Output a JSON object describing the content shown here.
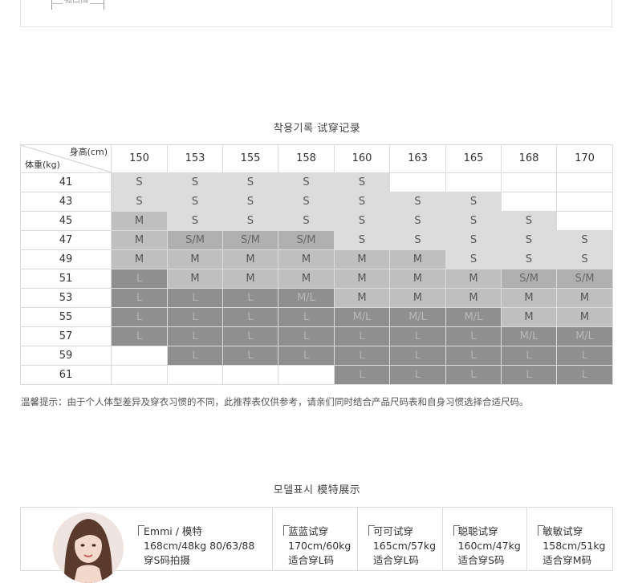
{
  "top_box": {
    "ruler_label": "袖口围"
  },
  "fit_section": {
    "title": "착용기록 试穿记录",
    "corner_height_label": "身高(cm)",
    "corner_weight_label": "体重(kg)",
    "heights": [
      "150",
      "153",
      "155",
      "158",
      "160",
      "163",
      "165",
      "168",
      "170"
    ],
    "rows": [
      {
        "weight": "41",
        "sizes": [
          "S",
          "S",
          "S",
          "S",
          "S",
          "",
          "",
          "",
          ""
        ]
      },
      {
        "weight": "43",
        "sizes": [
          "S",
          "S",
          "S",
          "S",
          "S",
          "S",
          "S",
          "",
          ""
        ]
      },
      {
        "weight": "45",
        "sizes": [
          "M",
          "S",
          "S",
          "S",
          "S",
          "S",
          "S",
          "S",
          ""
        ]
      },
      {
        "weight": "47",
        "sizes": [
          "M",
          "S/M",
          "S/M",
          "S/M",
          "S",
          "S",
          "S",
          "S",
          "S"
        ]
      },
      {
        "weight": "49",
        "sizes": [
          "M",
          "M",
          "M",
          "M",
          "M",
          "M",
          "S",
          "S",
          "S"
        ]
      },
      {
        "weight": "51",
        "sizes": [
          "L",
          "M",
          "M",
          "M",
          "M",
          "M",
          "M",
          "S/M",
          "S/M"
        ]
      },
      {
        "weight": "53",
        "sizes": [
          "L",
          "L",
          "L",
          "M/L",
          "M",
          "M",
          "M",
          "M",
          "M"
        ]
      },
      {
        "weight": "55",
        "sizes": [
          "L",
          "L",
          "L",
          "L",
          "M/L",
          "M/L",
          "M/L",
          "M",
          "M"
        ]
      },
      {
        "weight": "57",
        "sizes": [
          "L",
          "L",
          "L",
          "L",
          "L",
          "L",
          "L",
          "M/L",
          "M/L"
        ]
      },
      {
        "weight": "59",
        "sizes": [
          "",
          "L",
          "L",
          "L",
          "L",
          "L",
          "L",
          "L",
          "L"
        ]
      },
      {
        "weight": "61",
        "sizes": [
          "",
          "",
          "",
          "",
          "L",
          "L",
          "L",
          "L",
          "L"
        ]
      }
    ],
    "note": "温馨提示：由于个人体型差异及穿衣习惯的不同，此推荐表仅供参考，请亲们同时结合产品尺码表和自身习惯选择合适尺码。"
  },
  "models_section": {
    "title": "모델표시 模特展示",
    "models": [
      {
        "name": "Emmi / 模特",
        "line1": "168cm/48kg  80/63/88",
        "line2": "穿S码拍摄"
      },
      {
        "name": "蓝蓝试穿",
        "line1": "170cm/60kg",
        "line2": "适合穿L码"
      },
      {
        "name": "可可试穿",
        "line1": "165cm/57kg",
        "line2": "适合穿L码"
      },
      {
        "name": "聪聪试穿",
        "line1": "160cm/47kg",
        "line2": "适合穿S码"
      },
      {
        "name": "敏敏试穿",
        "line1": "158cm/51kg",
        "line2": "适合穿M码"
      }
    ]
  }
}
